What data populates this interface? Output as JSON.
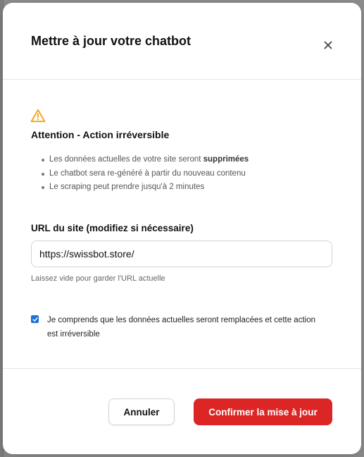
{
  "modal": {
    "title": "Mettre à jour votre chatbot",
    "close_icon": "close-icon"
  },
  "warning": {
    "icon": "warning-triangle-icon",
    "icon_color": "#f59e0b",
    "title": "Attention - Action irréversible",
    "bullets": [
      {
        "text": "Les données actuelles de votre site seront ",
        "strong": "supprimées"
      },
      {
        "text": "Le chatbot sera re-généré à partir du nouveau contenu"
      },
      {
        "text": "Le scraping peut prendre jusqu'à 2 minutes"
      }
    ]
  },
  "url_field": {
    "label": "URL du site (modifiez si nécessaire)",
    "value": "https://swissbot.store/",
    "hint": "Laissez vide pour garder l'URL actuelle"
  },
  "confirmation": {
    "checked": true,
    "label": "Je comprends que les données actuelles seront remplacées et cette action est irréversible"
  },
  "actions": {
    "cancel_label": "Annuler",
    "confirm_label": "Confirmer la mise à jour",
    "confirm_color": "#dc2626"
  }
}
